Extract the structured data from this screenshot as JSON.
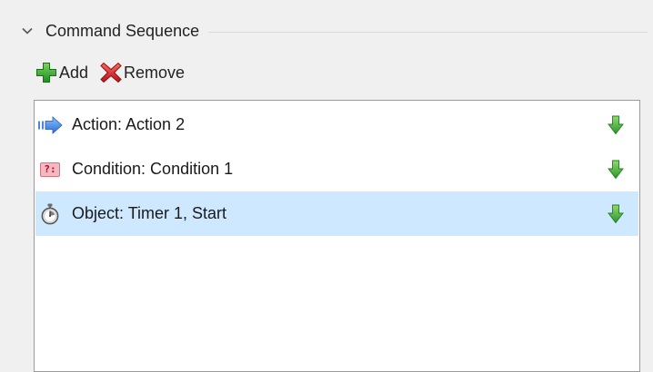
{
  "section": {
    "title": "Command Sequence",
    "expanded": true,
    "icon": "chevron-down-icon"
  },
  "toolbar": {
    "add_label": "Add",
    "add_icon": "plus-icon",
    "remove_label": "Remove",
    "remove_icon": "x-icon"
  },
  "command_list": {
    "items": [
      {
        "label": "Action: Action 2",
        "icon": "action-arrow-icon",
        "selected": false
      },
      {
        "label": "Condition: Condition 1",
        "icon": "condition-icon",
        "badge": "?:",
        "selected": false
      },
      {
        "label": "Object: Timer 1, Start",
        "icon": "stopwatch-icon",
        "selected": true
      }
    ],
    "row_action_icon": "move-down-icon"
  },
  "colors": {
    "selection": "#cde8ff",
    "add_green": "#2ea02e",
    "remove_red": "#d0181e",
    "action_blue": "#2f7ae0",
    "move_down_green": "#3aa73a"
  }
}
